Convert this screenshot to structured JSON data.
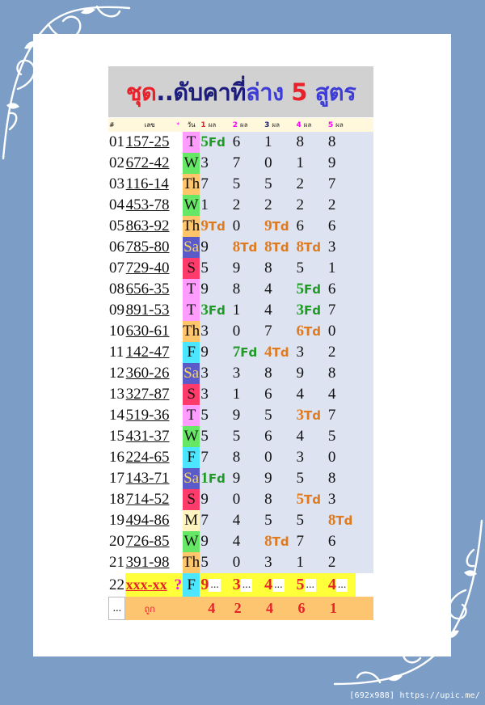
{
  "title": {
    "part1": "ชุด",
    "part2": "..",
    "part3": "ดับคาที่",
    "part4": "ล่าง",
    "part5": "5",
    "part6": "สูตร"
  },
  "header": {
    "no": "#",
    "number": "เลข",
    "star": "*",
    "day": "วัน",
    "formulas": [
      {
        "n": "1",
        "label": "ผล",
        "color": "#e8212b"
      },
      {
        "n": "2",
        "label": "ผล",
        "color": "#ff00ff"
      },
      {
        "n": "3",
        "label": "ผล",
        "color": "#1c1c7c"
      },
      {
        "n": "4",
        "label": "ผล",
        "color": "#ff00ff"
      },
      {
        "n": "5",
        "label": "ผล",
        "color": "#ff00ff"
      }
    ]
  },
  "day_colors": {
    "T": "#ff9cff",
    "W": "#66e866",
    "Th": "#ffc56a",
    "Sa": "#5a5ac8",
    "S": "#ff3b6b",
    "F": "#4de6ff",
    "M": "#fff4c0"
  },
  "rows": [
    {
      "no": "01",
      "num": "157-25",
      "day": "T",
      "f": [
        {
          "d": "5",
          "h": "Fd"
        },
        {
          "d": "6"
        },
        {
          "d": "1"
        },
        {
          "d": "8"
        },
        {
          "d": "8"
        }
      ]
    },
    {
      "no": "02",
      "num": "672-42",
      "day": "W",
      "f": [
        {
          "d": "3"
        },
        {
          "d": "7"
        },
        {
          "d": "0"
        },
        {
          "d": "1"
        },
        {
          "d": "9"
        }
      ]
    },
    {
      "no": "03",
      "num": "116-14",
      "day": "Th",
      "f": [
        {
          "d": "7"
        },
        {
          "d": "5"
        },
        {
          "d": "5"
        },
        {
          "d": "2"
        },
        {
          "d": "7"
        }
      ]
    },
    {
      "no": "04",
      "num": "453-78",
      "day": "W",
      "f": [
        {
          "d": "1"
        },
        {
          "d": "2"
        },
        {
          "d": "2"
        },
        {
          "d": "2"
        },
        {
          "d": "2"
        }
      ]
    },
    {
      "no": "05",
      "num": "863-92",
      "day": "Th",
      "f": [
        {
          "d": "9",
          "h": "Td"
        },
        {
          "d": "0"
        },
        {
          "d": "9",
          "h": "Td"
        },
        {
          "d": "6"
        },
        {
          "d": "6"
        }
      ]
    },
    {
      "no": "06",
      "num": "785-80",
      "day": "Sa",
      "f": [
        {
          "d": "9"
        },
        {
          "d": "8",
          "h": "Td"
        },
        {
          "d": "8",
          "h": "Td"
        },
        {
          "d": "8",
          "h": "Td"
        },
        {
          "d": "3"
        }
      ]
    },
    {
      "no": "07",
      "num": "729-40",
      "day": "S",
      "f": [
        {
          "d": "5"
        },
        {
          "d": "9"
        },
        {
          "d": "8"
        },
        {
          "d": "5"
        },
        {
          "d": "1"
        }
      ]
    },
    {
      "no": "08",
      "num": "656-35",
      "day": "T",
      "f": [
        {
          "d": "9"
        },
        {
          "d": "8"
        },
        {
          "d": "4"
        },
        {
          "d": "5",
          "h": "Fd"
        },
        {
          "d": "6"
        }
      ]
    },
    {
      "no": "09",
      "num": "891-53",
      "day": "T",
      "f": [
        {
          "d": "3",
          "h": "Fd"
        },
        {
          "d": "1"
        },
        {
          "d": "4"
        },
        {
          "d": "3",
          "h": "Fd"
        },
        {
          "d": "7"
        }
      ]
    },
    {
      "no": "10",
      "num": "630-61",
      "day": "Th",
      "f": [
        {
          "d": "3"
        },
        {
          "d": "0"
        },
        {
          "d": "7"
        },
        {
          "d": "6",
          "h": "Td"
        },
        {
          "d": "0"
        }
      ]
    },
    {
      "no": "11",
      "num": "142-47",
      "day": "F",
      "f": [
        {
          "d": "9"
        },
        {
          "d": "7",
          "h": "Fd"
        },
        {
          "d": "4",
          "h": "Td"
        },
        {
          "d": "3"
        },
        {
          "d": "2"
        }
      ]
    },
    {
      "no": "12",
      "num": "360-26",
      "day": "Sa",
      "f": [
        {
          "d": "3"
        },
        {
          "d": "3"
        },
        {
          "d": "8"
        },
        {
          "d": "9"
        },
        {
          "d": "8"
        }
      ]
    },
    {
      "no": "13",
      "num": "327-87",
      "day": "S",
      "f": [
        {
          "d": "3"
        },
        {
          "d": "1"
        },
        {
          "d": "6"
        },
        {
          "d": "4"
        },
        {
          "d": "4"
        }
      ]
    },
    {
      "no": "14",
      "num": "519-36",
      "day": "T",
      "f": [
        {
          "d": "5"
        },
        {
          "d": "9"
        },
        {
          "d": "5"
        },
        {
          "d": "3",
          "h": "Td"
        },
        {
          "d": "7"
        }
      ]
    },
    {
      "no": "15",
      "num": "431-37",
      "day": "W",
      "f": [
        {
          "d": "5"
        },
        {
          "d": "5"
        },
        {
          "d": "6"
        },
        {
          "d": "4"
        },
        {
          "d": "5"
        }
      ]
    },
    {
      "no": "16",
      "num": "224-65",
      "day": "F",
      "f": [
        {
          "d": "7"
        },
        {
          "d": "8"
        },
        {
          "d": "0"
        },
        {
          "d": "3"
        },
        {
          "d": "0"
        }
      ]
    },
    {
      "no": "17",
      "num": "143-71",
      "day": "Sa",
      "f": [
        {
          "d": "1",
          "h": "Fd"
        },
        {
          "d": "9"
        },
        {
          "d": "9"
        },
        {
          "d": "5"
        },
        {
          "d": "8"
        }
      ]
    },
    {
      "no": "18",
      "num": "714-52",
      "day": "S",
      "f": [
        {
          "d": "9"
        },
        {
          "d": "0"
        },
        {
          "d": "8"
        },
        {
          "d": "5",
          "h": "Td"
        },
        {
          "d": "3"
        }
      ]
    },
    {
      "no": "19",
      "num": "494-86",
      "day": "M",
      "f": [
        {
          "d": "7"
        },
        {
          "d": "4"
        },
        {
          "d": "5"
        },
        {
          "d": "5"
        },
        {
          "d": "8",
          "h": "Td"
        }
      ]
    },
    {
      "no": "20",
      "num": "726-85",
      "day": "W",
      "f": [
        {
          "d": "9"
        },
        {
          "d": "4"
        },
        {
          "d": "8",
          "h": "Td"
        },
        {
          "d": "7"
        },
        {
          "d": "6"
        }
      ]
    },
    {
      "no": "21",
      "num": "391-98",
      "day": "Th",
      "f": [
        {
          "d": "5"
        },
        {
          "d": "0"
        },
        {
          "d": "3"
        },
        {
          "d": "1"
        },
        {
          "d": "2"
        }
      ]
    }
  ],
  "prediction": {
    "no": "22",
    "num": "xxx-xx",
    "mark": "?",
    "day": "F",
    "f": [
      "9",
      "3",
      "4",
      "5",
      "4"
    ],
    "dots": "..."
  },
  "score": {
    "ellipsis": "...",
    "label": "ถูก",
    "values": [
      "4",
      "2",
      "4",
      "6",
      "1"
    ]
  },
  "watermark": "[692x988] https://upic.me/"
}
